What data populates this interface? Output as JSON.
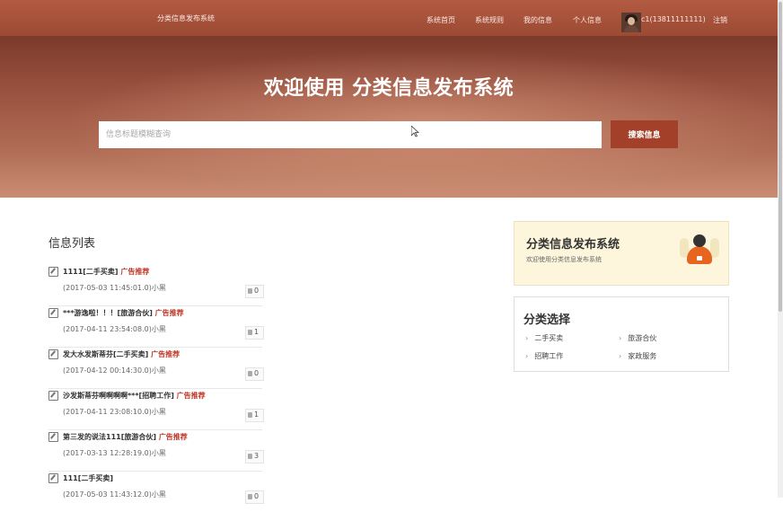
{
  "header": {
    "brand": "分类信息发布系统",
    "nav": [
      "系统首页",
      "系统规则",
      "我的信息",
      "个人信息"
    ],
    "user": "c1(13811111111)",
    "logout": "注销"
  },
  "hero": {
    "title": "欢迎使用 分类信息发布系统",
    "search_placeholder": "信息标题模糊查询",
    "search_button": "搜索信息"
  },
  "main": {
    "section_title": "信息列表",
    "items": [
      {
        "title": "1111[二手买卖]",
        "ad": "广告推荐",
        "meta": "(2017-05-03 11:45:01.0)小黑",
        "likes": "0"
      },
      {
        "title": "***游逸啦！！！[旅游合伙]",
        "ad": "广告推荐",
        "meta": "(2017-04-11 23:54:08.0)小黑",
        "likes": "1"
      },
      {
        "title": "发大水发斯蒂芬[二手买卖]",
        "ad": "广告推荐",
        "meta": "(2017-04-12 00:14:30.0)小黑",
        "likes": "0"
      },
      {
        "title": "沙发斯蒂芬啊啊啊啊***[招聘工作]",
        "ad": "广告推荐",
        "meta": "(2017-04-11 23:08:10.0)小黑",
        "likes": "1"
      },
      {
        "title": "第三发的说法111[旅游合伙]",
        "ad": "广告推荐",
        "meta": "(2017-03-13 12:28:19.0)小黑",
        "likes": "3"
      },
      {
        "title": "111[二手买卖]",
        "ad": "",
        "meta": "(2017-05-03 11:43:12.0)小黑",
        "likes": "0"
      }
    ]
  },
  "sidebar": {
    "promo_title": "分类信息发布系统",
    "promo_sub": "欢迎使用分类信息发布系统",
    "category_title": "分类选择",
    "categories": [
      "二手买卖",
      "旅游合伙",
      "招聘工作",
      "家政服务"
    ]
  }
}
